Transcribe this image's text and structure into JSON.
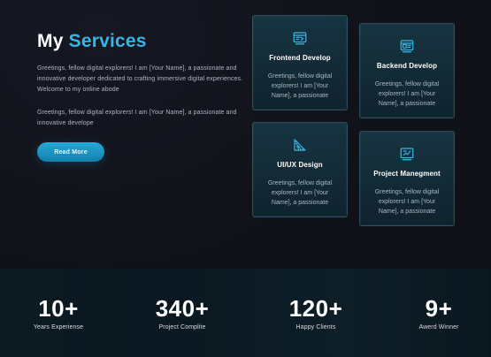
{
  "services": {
    "title_part1": "My",
    "title_part2": "Services",
    "paragraph1": "Greetings, fellow digital explorers! I am [Your Name], a passionate and innovative developer dedicated to crafting immersive digital experiences. Welcome to my online abode",
    "paragraph2": "Greetings, fellow digital explorers! I am [Your Name], a passionate and innovative develope",
    "button_label": "Read More",
    "cards": [
      {
        "title": "Frontend Develop",
        "text": "Greetings, fellow digital explorers! I am [Your Name], a passionate",
        "icon": "frontend-icon"
      },
      {
        "title": "Backend Develop",
        "text": "Greetings, fellow digital explorers! I am [Your Name], a passionate",
        "icon": "backend-icon"
      },
      {
        "title": "UI/UX Design",
        "text": "Greetings, fellow digital explorers! I am [Your Name], a passionate",
        "icon": "design-icon"
      },
      {
        "title": "Project Manegment",
        "text": "Greetings, fellow digital explorers! I am [Your Name], a passionate",
        "icon": "project-icon"
      }
    ]
  },
  "stats": [
    {
      "value": "10+",
      "label": "Years Experiense"
    },
    {
      "value": "340+",
      "label": "Project Complite"
    },
    {
      "value": "120+",
      "label": "Happy Clients"
    },
    {
      "value": "9+",
      "label": "Awerd Winner"
    }
  ],
  "colors": {
    "accent": "#36b6e6",
    "button": "#1f97c6",
    "background": "#111218",
    "card": "#17323f",
    "stats_bg": "#0c1a22"
  }
}
